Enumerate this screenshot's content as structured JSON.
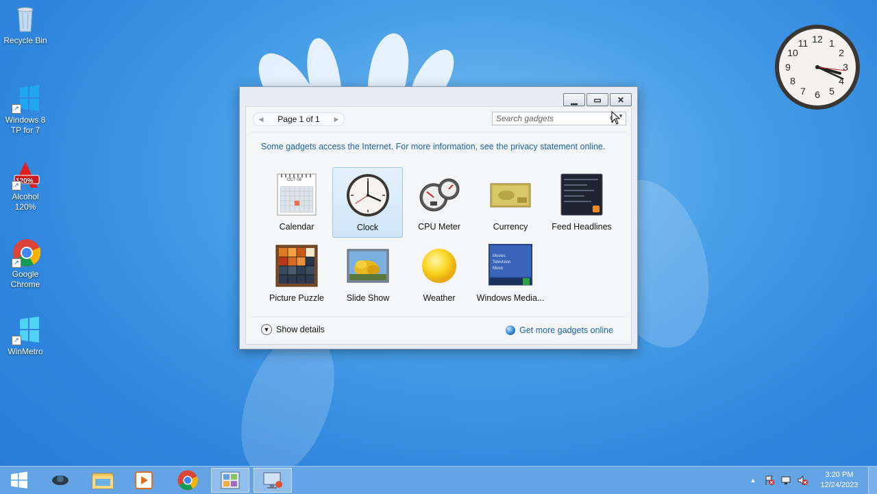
{
  "desktop": {
    "icons": [
      {
        "label": "Recycle Bin",
        "icon": "recycle-bin-icon"
      },
      {
        "label": "Windows 8 TP for 7",
        "icon": "windows-logo-icon"
      },
      {
        "label": "Alcohol 120%",
        "icon": "alcohol-120-icon",
        "badge": "120%"
      },
      {
        "label": "Google Chrome",
        "icon": "chrome-icon"
      },
      {
        "label": "WinMetro",
        "icon": "windows-logo-icon"
      }
    ],
    "clock_numbers": [
      "12",
      "1",
      "2",
      "3",
      "4",
      "5",
      "6",
      "7",
      "8",
      "9",
      "10",
      "11"
    ]
  },
  "gallery": {
    "controls": {
      "minimize": "minimize-icon",
      "maximize": "maximize-icon",
      "close": "close-icon"
    },
    "pager": {
      "label": "Page 1 of 1"
    },
    "search": {
      "placeholder": "Search gadgets"
    },
    "notice": "Some gadgets access the Internet.  For more information, see the privacy statement online.",
    "gadgets": [
      {
        "label": "Calendar",
        "icon": "calendar-icon",
        "month": "OCT 08"
      },
      {
        "label": "Clock",
        "icon": "clock-icon",
        "selected": true
      },
      {
        "label": "CPU Meter",
        "icon": "cpu-meter-icon"
      },
      {
        "label": "Currency",
        "icon": "currency-icon"
      },
      {
        "label": "Feed Headlines",
        "icon": "feed-headlines-icon"
      },
      {
        "label": "Picture Puzzle",
        "icon": "picture-puzzle-icon"
      },
      {
        "label": "Slide Show",
        "icon": "slide-show-icon"
      },
      {
        "label": "Weather",
        "icon": "weather-icon"
      },
      {
        "label": "Windows Media...",
        "icon": "windows-media-center-icon",
        "menu": [
          "Movies",
          "Television",
          "Music"
        ]
      }
    ],
    "show_details": "Show details",
    "get_more": "Get more gadgets online"
  },
  "taskbar": {
    "buttons": [
      "start-icon",
      "network-app-icon",
      "file-explorer-icon",
      "media-player-icon",
      "chrome-icon",
      "gadgets-icon",
      "display-icon"
    ],
    "clock": {
      "time": "3:20 PM",
      "date": "12/24/2023"
    },
    "tray_icons": [
      "show-hidden-icon",
      "action-center-icon",
      "network-icon",
      "volume-muted-icon"
    ]
  }
}
